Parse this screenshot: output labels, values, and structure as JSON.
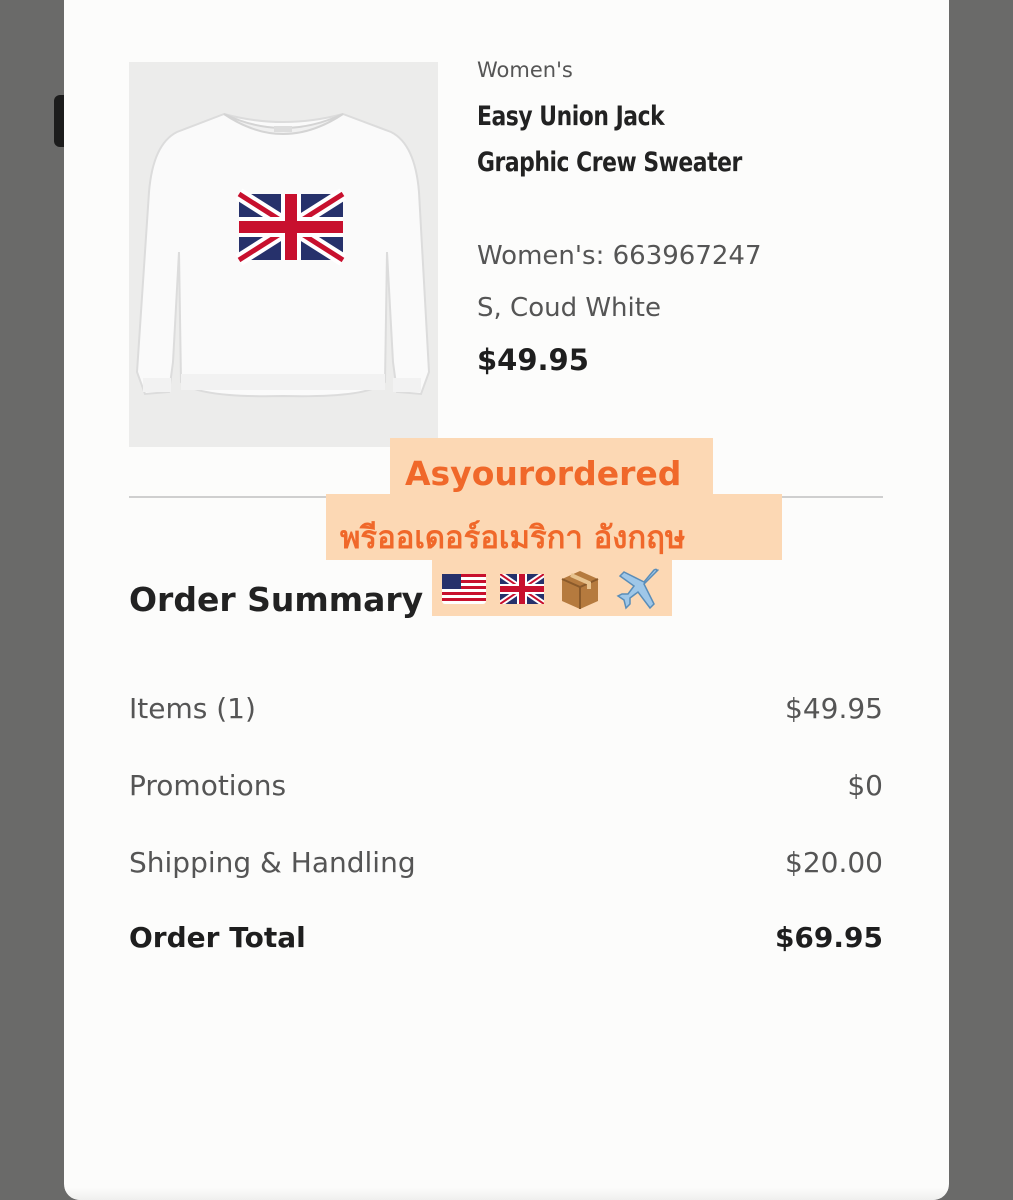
{
  "product": {
    "category": "Women's",
    "name_line1": "Easy Union Jack",
    "name_line2": "Graphic Crew Sweater",
    "sku": "Women's: 663967247",
    "variant": "S, Coud White",
    "price": "$49.95",
    "image": "sweater-union-jack"
  },
  "overlay": {
    "line1": "Asyourordered",
    "line2": "พรีออเดอร์อเมริกา อังกฤษ",
    "icons": [
      "us-flag-icon",
      "uk-flag-icon",
      "package-icon",
      "airplane-icon"
    ],
    "accent": "#f0682a",
    "background": "#fcd8b4"
  },
  "summary": {
    "title": "Order Summary",
    "rows": [
      {
        "label": "Items (1)",
        "value": "$49.95"
      },
      {
        "label": "Promotions",
        "value": "$0"
      },
      {
        "label": "Shipping & Handling",
        "value": "$20.00"
      }
    ],
    "total_label": "Order Total",
    "total_value": "$69.95"
  }
}
